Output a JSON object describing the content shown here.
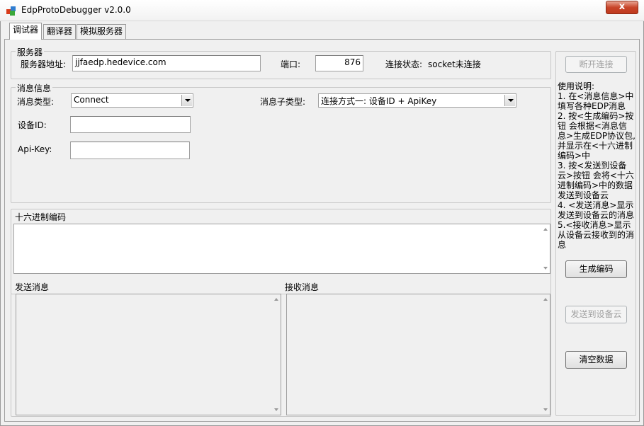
{
  "window": {
    "title": "EdpProtoDebugger v2.0.0",
    "close_label": "x"
  },
  "tabs": [
    "调试器",
    "翻译器",
    "模拟服务器"
  ],
  "server": {
    "legend": "服务器",
    "address_label": "服务器地址:",
    "address_value": "jjfaedp.hedevice.com",
    "port_label": "端口:",
    "port_value": "876",
    "status_label": "连接状态:",
    "status_value": "socket未连接"
  },
  "message": {
    "legend": "消息信息",
    "type_label": "消息类型:",
    "type_value": "Connect",
    "subtype_label": "消息子类型:",
    "subtype_value": "连接方式一: 设备ID + ApiKey",
    "device_id_label": "设备ID:",
    "device_id_value": "",
    "apikey_label": "Api-Key:",
    "apikey_value": ""
  },
  "hex": {
    "label": "十六进制编码",
    "value": ""
  },
  "send": {
    "label": "发送消息"
  },
  "receive": {
    "label": "接收消息"
  },
  "side": {
    "disconnect_label": "断开连接",
    "help_lines": [
      "使用说明:",
      "1. 在<消息信息>中",
      "填写各种EDP消息",
      "2. 按<生成编码>按",
      "钮 会根据<消息信",
      "息>生成EDP协议包,",
      "并显示在<十六进制",
      "编码>中",
      "3. 按<发送到设备",
      "云>按钮 会将<十六",
      "进制编码>中的数据",
      "发送到设备云",
      "4. <发送消息>显示",
      "发送到设备云的消息",
      "5.<接收消息>显示",
      "从设备云接收到的消",
      "息"
    ],
    "generate_label": "生成编码",
    "send_cloud_label": "发送到设备云",
    "clear_label": "清空数据"
  }
}
